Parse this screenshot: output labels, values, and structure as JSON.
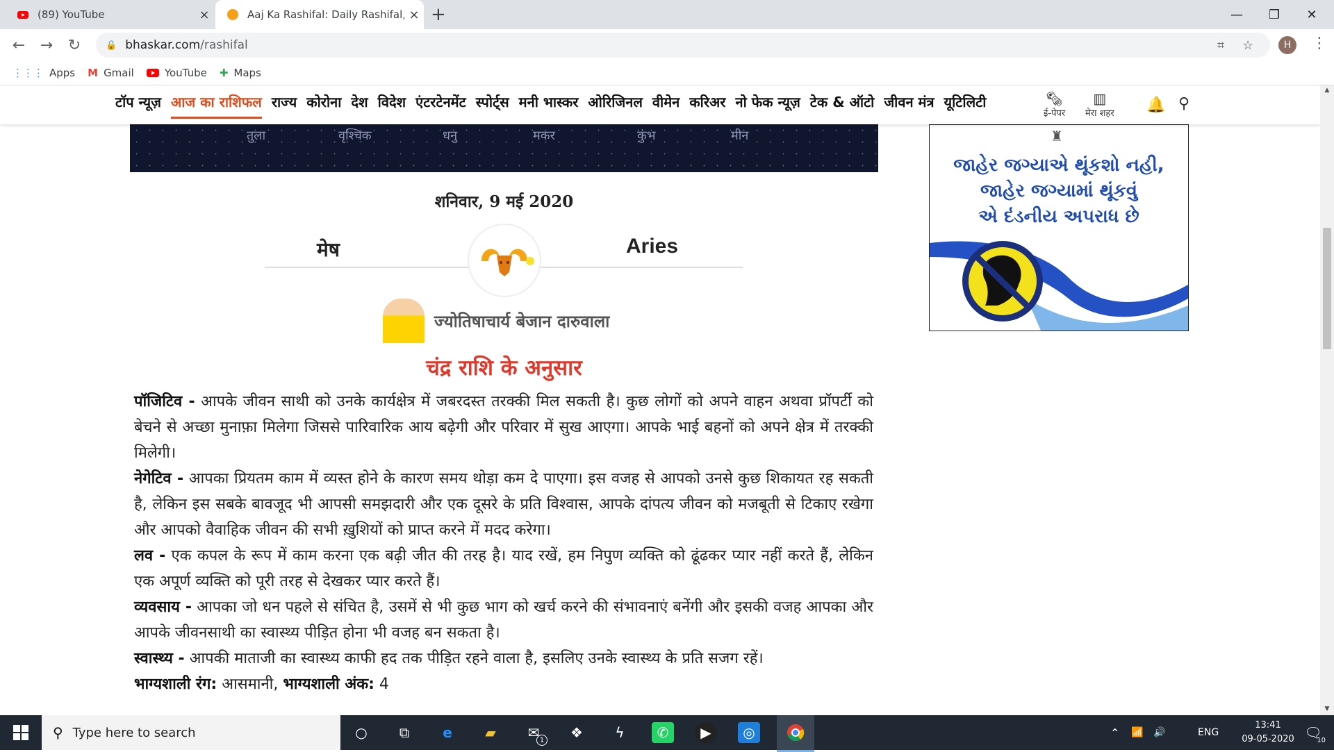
{
  "browser": {
    "tabs": [
      {
        "title": "(89) YouTube",
        "close": "×"
      },
      {
        "title": "Aaj Ka Rashifal: Daily Rashifal, To",
        "close": "×"
      }
    ],
    "new_tab": "+",
    "url_host": "bhaskar.com",
    "url_path": "/rashifal",
    "profile_initial": "H",
    "bookmarks": [
      {
        "label": "Apps",
        "icon": "apps-grid-icon"
      },
      {
        "label": "Gmail",
        "icon": "gmail-icon"
      },
      {
        "label": "YouTube",
        "icon": "youtube-icon"
      },
      {
        "label": "Maps",
        "icon": "maps-icon"
      }
    ]
  },
  "site": {
    "nav": [
      "टॉप न्यूज़",
      "आज का राशिफल",
      "राज्य",
      "कोरोना",
      "देश",
      "विदेश",
      "एंटरटेनमेंट",
      "स्पोर्ट्स",
      "मनी भास्कर",
      "ओरिजिनल",
      "वीमेन",
      "करिअर",
      "नो फेक न्यूज़",
      "टेक & ऑटो",
      "जीवन मंत्र",
      "यूटिलिटी"
    ],
    "active_nav_index": 1,
    "epaper_label": "ई-पेपर",
    "my_city_label": "मेरा शहर",
    "banner_labels": [
      "तुला",
      "वृश्चिक",
      "धनु",
      "मकर",
      "कुंभ",
      "मीन"
    ],
    "date": "शनिवार, 9 मई 2020",
    "sign_hindi": "मेष",
    "sign_english": "Aries",
    "author": "ज्योतिषाचार्य बेजान दारुवाला",
    "subheading": "चंद्र राशि के अनुसार",
    "sections": [
      {
        "label": "पॉजिटिव -",
        "text": " आपके जीवन साथी को उनके कार्यक्षेत्र में जबरदस्त तरक्की मिल सकती है। कुछ लोगों को अपने वाहन अथवा प्रॉपर्टी को बेचने से अच्छा मुनाफ़ा मिलेगा जिससे पारिवारिक आय बढ़ेगी और परिवार में सुख आएगा। आपके भाई बहनों को अपने क्षेत्र में तरक्की मिलेगी।"
      },
      {
        "label": "नेगेटिव -",
        "text": " आपका प्रियतम काम में व्यस्त होने के कारण समय थोड़ा कम दे पाएगा। इस वजह से आपको उनसे कुछ शिकायत रह सकती है, लेकिन इस सबके बावजूद भी आपसी समझदारी और एक दूसरे के प्रति विश्वास, आपके दांपत्य जीवन को मजबूती से टिकाए रखेगा और आपको वैवाहिक जीवन की सभी ख़ुशियों को प्राप्त करने में मदद करेगा।"
      },
      {
        "label": "लव -",
        "text": " एक कपल के रूप में काम करना एक बढ़ी जीत की तरह है। याद रखें, हम निपुण व्यक्ति को ढूंढकर प्यार नहीं करते हैं, लेकिन एक अपूर्ण व्यक्ति को पूरी तरह से देखकर प्यार करते हैं।"
      },
      {
        "label": "व्यवसाय -",
        "text": " आपका जो धन पहले से संचित है, उसमें से भी कुछ भाग को खर्च करने की संभावनाएं बनेंगी और इसकी वजह आपका और आपके जीवनसाथी का स्वास्थ्य पीड़ित होना भी वजह बन सकता है।"
      },
      {
        "label": "स्वास्थ्य -",
        "text": " आपकी माताजी का स्वास्थ्य काफी हद तक पीड़ित रहने वाला है, इसलिए उनके स्वास्थ्य के प्रति सजग रहें।"
      }
    ],
    "lucky_color_label": "भाग्यशाली रंग:",
    "lucky_color": " आसमानी,",
    "lucky_number_label": "भाग्यशाली अंक:",
    "lucky_number": " 4",
    "ad_lines": [
      "જાહેર જગ્યાએ થૂંકશો નહી,",
      "જાહેર જગ્યામાં થૂંકવું",
      "એ દંડનીય અપરાધ છે"
    ]
  },
  "taskbar": {
    "search_placeholder": "Type here to search",
    "language": "ENG",
    "time": "13:41",
    "date": "09-05-2020",
    "notification_count": "10",
    "mail_badge": "1"
  },
  "colors": {
    "accent": "#e04b1c",
    "subheading": "#dd3a2c",
    "ad_text": "#1f4cae"
  }
}
